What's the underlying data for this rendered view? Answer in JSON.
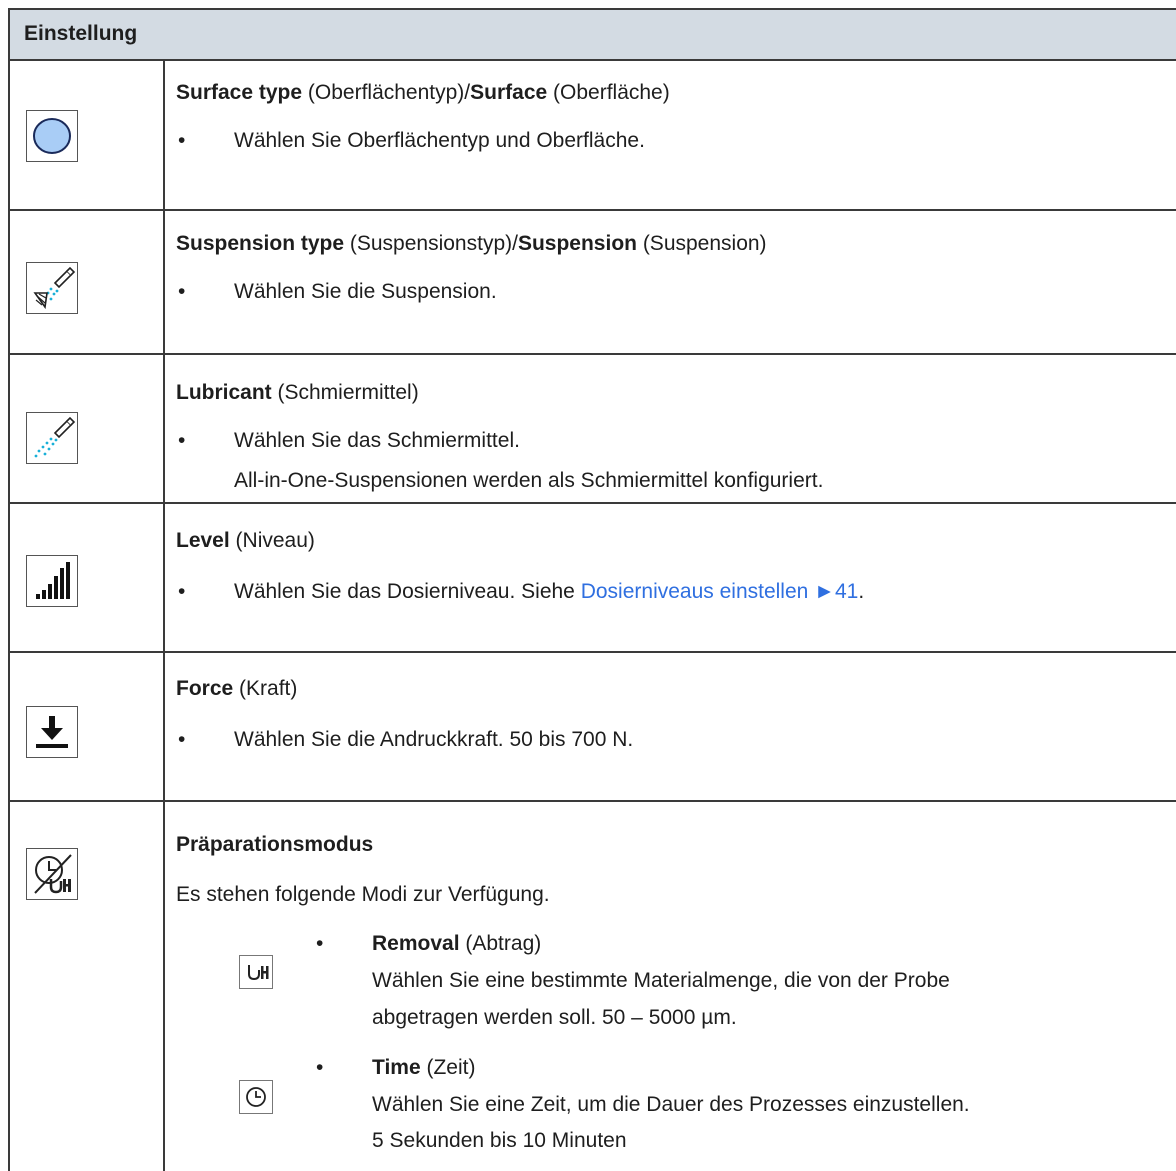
{
  "header": {
    "title": "Einstellung"
  },
  "rows": [
    {
      "icon": "surface-icon",
      "title_bold": "Surface type",
      "title_paren": " (Oberflächentyp)/",
      "title_bold2": "Surface",
      "title_paren2": " (Oberfläche)",
      "bullet": "•",
      "text": "Wählen Sie Oberflächentyp und Oberfläche."
    },
    {
      "icon": "suspension-spray-icon",
      "title_bold": "Suspension type",
      "title_paren": " (Suspensionstyp)/",
      "title_bold2": "Suspension",
      "title_paren2": " (Suspension)",
      "bullet": "•",
      "text": "Wählen Sie die Suspension."
    },
    {
      "icon": "lubricant-spray-icon",
      "title_bold": "Lubricant",
      "title_paren": " (Schmiermittel)",
      "bullet": "•",
      "text": "Wählen Sie das Schmiermittel.",
      "note": "All-in-One-Suspensionen werden als Schmiermittel konfiguriert."
    },
    {
      "icon": "level-bars-icon",
      "title_bold": "Level",
      "title_paren": " (Niveau)",
      "bullet": "•",
      "text": "Wählen Sie das Dosierniveau. Siehe ",
      "link": "Dosierniveaus einstellen ►41",
      "after_link": "."
    },
    {
      "icon": "force-down-arrow-icon",
      "title_bold": "Force",
      "title_paren": " (Kraft)",
      "bullet": "•",
      "text": "Wählen Sie die Andruckkraft. 50 bis 700 N."
    },
    {
      "icon": "preparation-mode-icon",
      "title_bold": "Präparationsmodus",
      "intro": "Es stehen folgende Modi zur Verfügung.",
      "modes": [
        {
          "icon": "removal-icon",
          "bullet": "•",
          "name_bold": "Removal",
          "name_paren": " (Abtrag)",
          "line1": "Wählen Sie eine bestimmte Materialmenge, die von der Probe",
          "line2": "abgetragen werden soll. 50 – 5000 µm."
        },
        {
          "icon": "time-clock-icon",
          "bullet": "•",
          "name_bold": "Time",
          "name_paren": " (Zeit)",
          "line1": "Wählen Sie eine Zeit, um die Dauer des Prozesses einzustellen.",
          "line2": "5 Sekunden bis 10 Minuten"
        }
      ]
    }
  ]
}
